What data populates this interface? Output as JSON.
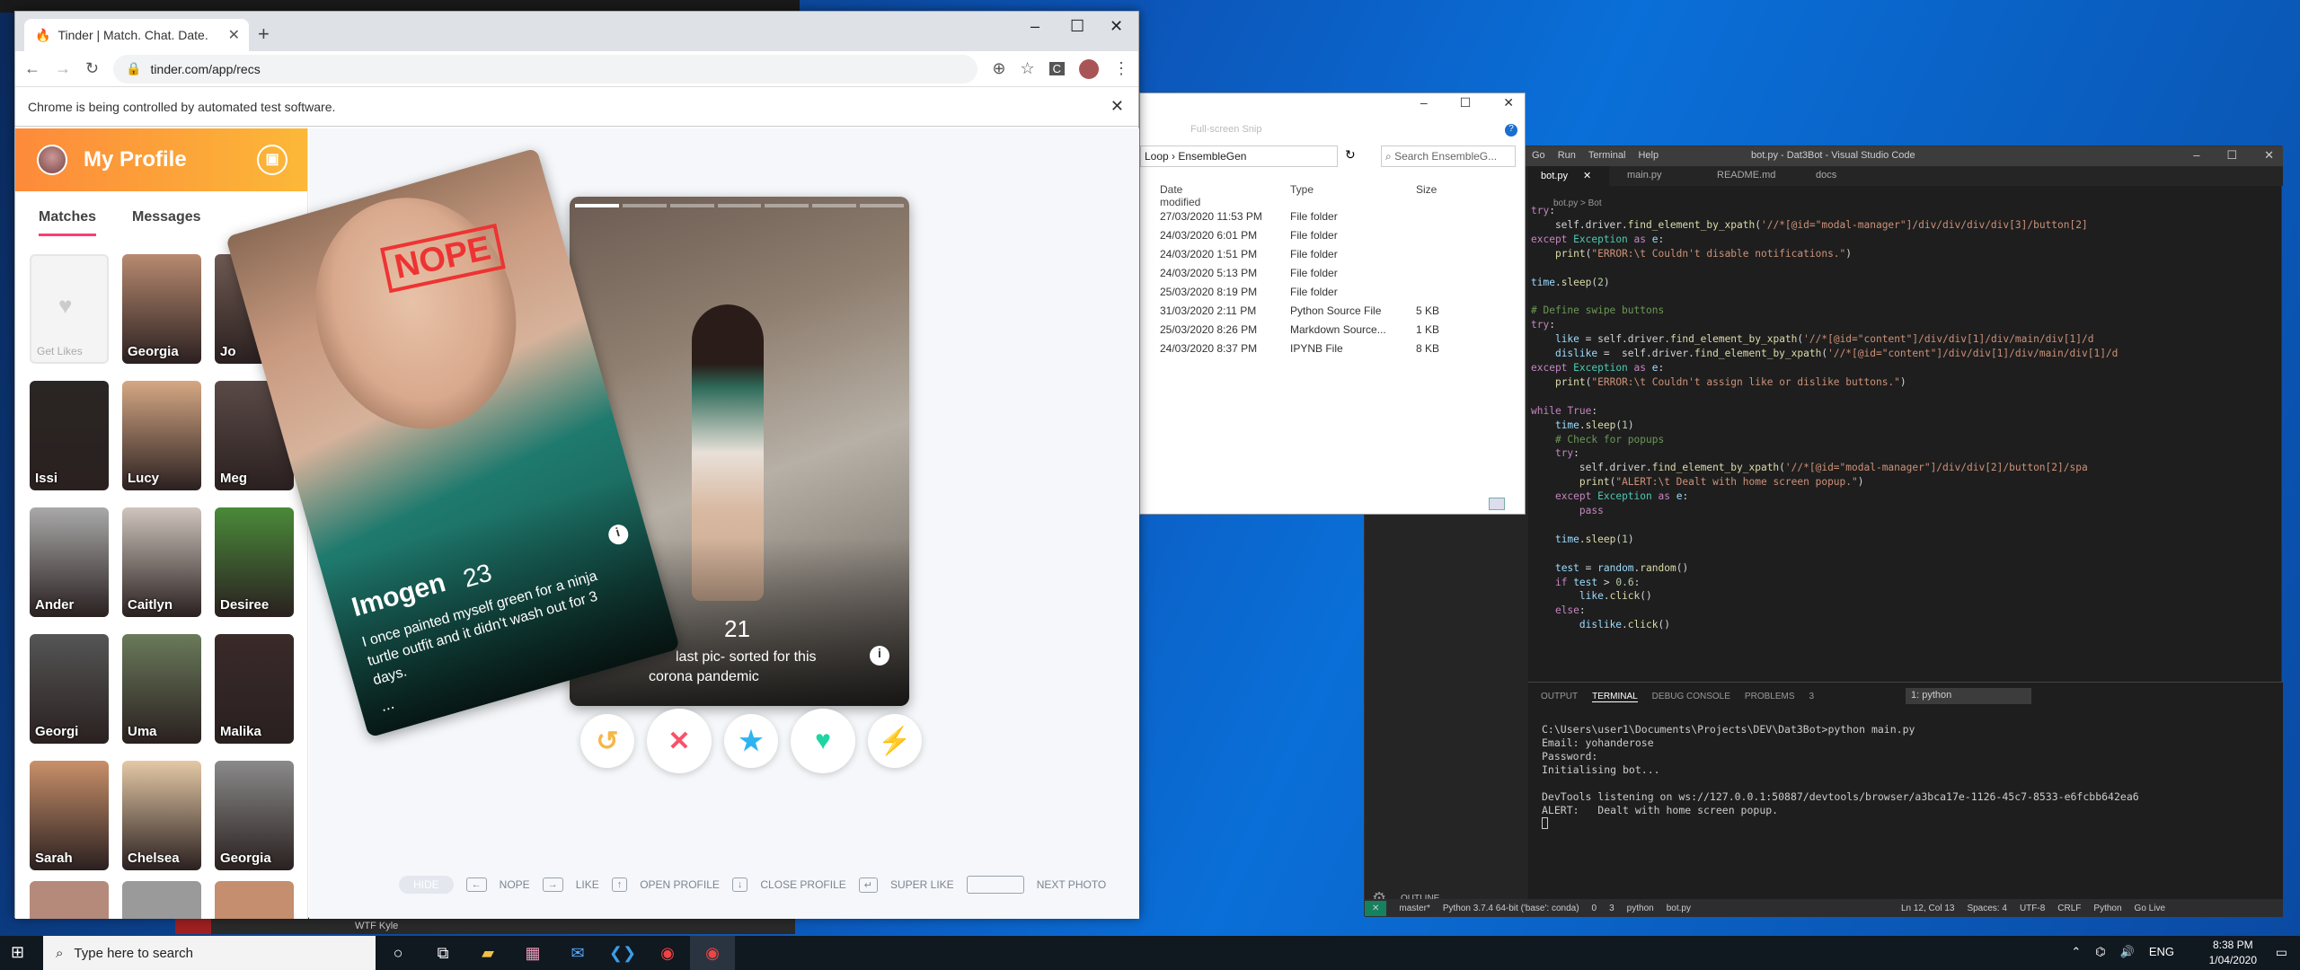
{
  "browser": {
    "tab_title": "Tinder | Match. Chat. Date.",
    "url": "tinder.com/app/recs",
    "automation_banner": "Chrome is being controlled by automated test software."
  },
  "sidebar": {
    "title": "My Profile",
    "tabs": [
      "Matches",
      "Messages"
    ],
    "matches": [
      {
        "name": "Get Likes"
      },
      {
        "name": "Georgia"
      },
      {
        "name": "Jo"
      },
      {
        "name": "Issi"
      },
      {
        "name": "Lucy"
      },
      {
        "name": "Meg"
      },
      {
        "name": "Ander"
      },
      {
        "name": "Caitlyn"
      },
      {
        "name": "Desiree"
      },
      {
        "name": "Georgi"
      },
      {
        "name": "Uma"
      },
      {
        "name": "Malika"
      },
      {
        "name": "Sarah"
      },
      {
        "name": "Chelsea"
      },
      {
        "name": "Georgia"
      }
    ]
  },
  "card_front": {
    "stamp": "NOPE",
    "name": "Imogen",
    "age": "23",
    "bio": "I once painted myself green for a ninja turtle outfit and it didn't wash out for 3 days.",
    "more": "..."
  },
  "card_back": {
    "age": "21",
    "bio": "last pic- sorted for this",
    "bio2": "corona pandemic"
  },
  "hints": {
    "hide": "HIDE",
    "nope": "NOPE",
    "like": "LIKE",
    "open": "OPEN PROFILE",
    "close": "CLOSE PROFILE",
    "super": "SUPER LIKE",
    "next": "NEXT PHOTO"
  },
  "explorer": {
    "breadcrumb_a": "Loop",
    "breadcrumb_b": "EnsembleGen",
    "search": "Search EnsembleG...",
    "tooltip": "Full-screen Snip",
    "cols": [
      "Date modified",
      "Type",
      "Size"
    ],
    "rows": [
      [
        "27/03/2020 11:53 PM",
        "File folder",
        ""
      ],
      [
        "24/03/2020 6:01 PM",
        "File folder",
        ""
      ],
      [
        "24/03/2020 1:51 PM",
        "File folder",
        ""
      ],
      [
        "24/03/2020 5:13 PM",
        "File folder",
        ""
      ],
      [
        "25/03/2020 8:19 PM",
        "File folder",
        ""
      ],
      [
        "31/03/2020 2:11 PM",
        "Python Source File",
        "5 KB"
      ],
      [
        "25/03/2020 8:26 PM",
        "Markdown Source...",
        "1 KB"
      ],
      [
        "24/03/2020 8:37 PM",
        "IPYNB File",
        "8 KB"
      ]
    ]
  },
  "vscode": {
    "title": "bot.py - Dat3Bot - Visual Studio Code",
    "menu": [
      "Go",
      "Run",
      "Terminal",
      "Help"
    ],
    "tabs": [
      "bot.py",
      "main.py",
      "README.md",
      "docs"
    ],
    "breadcrumb": "bot.py > Bot",
    "panel_tabs": [
      "OUTPUT",
      "TERMINAL",
      "DEBUG CONSOLE",
      "PROBLEMS"
    ],
    "problems_count": "3",
    "terminal_select": "1: python",
    "terminal": [
      "C:\\Users\\user1\\Documents\\Projects\\DEV\\Dat3Bot>python main.py",
      "Email: yohanderose",
      "Password:",
      "Initialising bot...",
      "",
      "DevTools listening on ws://127.0.0.1:50887/devtools/browser/a3bca17e-1126-45c7-8533-e6fcbb642ea6",
      "ALERT:   Dealt with home screen popup."
    ],
    "outline": "OUTLINE",
    "status": {
      "branch": "master*",
      "python": "Python 3.7.4 64-bit ('base': conda)",
      "errors": "0",
      "warnings": "3",
      "env": "python",
      "file": "bot.py",
      "pos": "Ln 12, Col 13",
      "spaces": "Spaces: 4",
      "enc": "UTF-8",
      "eol": "CRLF",
      "lang": "Python",
      "live": "Go Live"
    }
  },
  "taskbar": {
    "search": "Type here to search",
    "behind_label": "WTF Kyle",
    "lang": "ENG",
    "time": "8:38 PM",
    "date": "1/04/2020"
  },
  "colors": {
    "tinder_pink": "#fe3c72",
    "tinder_orange": "#fd8a3a",
    "vscode_bg": "#1e1e1e",
    "taskbar": "#101820"
  }
}
